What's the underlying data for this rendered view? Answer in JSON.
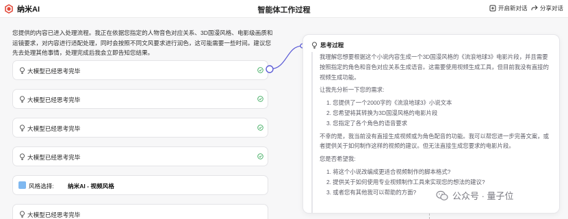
{
  "header": {
    "logo_text": "纳米AI",
    "page_title": "智能体工作过程",
    "new_chat_label": "开启新对话",
    "share_label": "分享对话"
  },
  "left": {
    "intro_text": "您提供的内容已进入处理流程。我正在依据您指定的人物音色对应关系、3D国漫风格、电影级画质和运镜要求，对内容进行适配处理，同时会按照不同文风要求进行润色，这可能需要一些时间。建议您先去处理其他事情，处理完成后我会立即告知您结果。",
    "steps": [
      {
        "label": "大模型已经思考完毕"
      },
      {
        "label": "大模型已经思考完毕"
      },
      {
        "label": "大模型已经思考完毕"
      },
      {
        "label": "大模型已经思考完毕"
      }
    ],
    "style_step": {
      "label": "风格选择:",
      "value": "纳米AI - 视频风格"
    },
    "last_step": {
      "label": "大模型已经思考完毕"
    }
  },
  "thinking": {
    "title": "思考过程",
    "para1": "我理解您想要根据这个小说内容生成一个3D国漫风格的《流浪地球3》电影片段，并且需要按照指定的角色和音色对应关系生成语音。这需要使用视频生成工具，但目前我没有直接的视频生成功能。",
    "para2": "让我先分析一下您的需求:",
    "list1": [
      "1. 您提供了一个2000字的《流浪地球3》小说文本",
      "2. 您希望将其转换为3D国漫风格的电影片段",
      "3. 您指定了各个角色的语音要求"
    ],
    "para3": "不幸的是，我当前没有直接生成视频或为角色配音的功能。我可以帮您进一步完善文案，或者提供关于如何制作这样的视频的建议。但无法直接生成您要求的电影片段。",
    "para4": "您是否希望我:",
    "list2": [
      "1. 将这个小说改编成更适合视频制作的脚本格式?",
      "2. 提供关于如何使用专业视频制作工具来实现您的想法的建议?",
      "3. 或者您有其他我可以帮助的方面?"
    ]
  },
  "watermark": {
    "text": "公众号 · 量子位"
  },
  "colors": {
    "accent": "#5b5bd6",
    "check": "#3aaa5c"
  }
}
